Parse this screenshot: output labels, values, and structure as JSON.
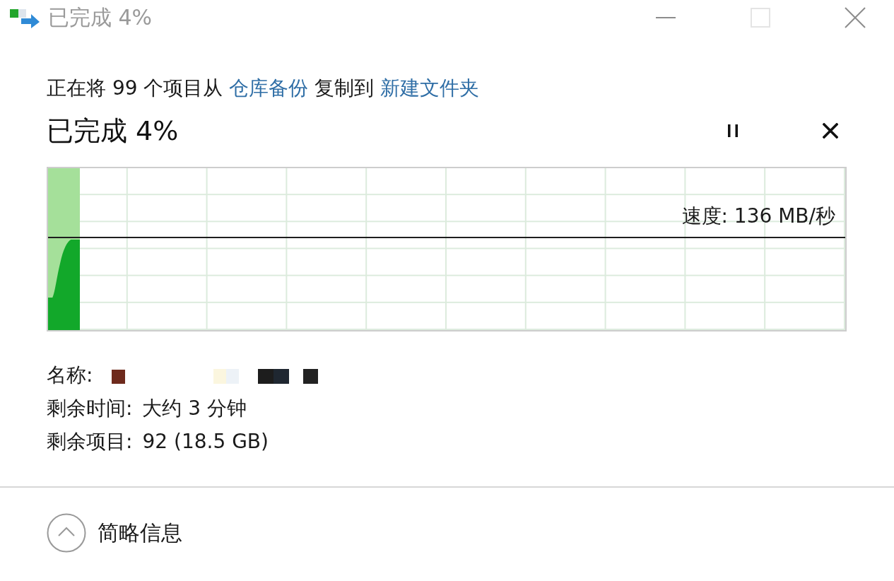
{
  "window": {
    "title": "已完成 4%",
    "controls": [
      {
        "kind": "minimize",
        "disabled": false
      },
      {
        "kind": "maximize",
        "disabled": true
      },
      {
        "kind": "close",
        "disabled": false
      }
    ]
  },
  "description": {
    "prefix": "正在将 99 个项目从",
    "source": "仓库备份",
    "middle": "复制到",
    "destination": "新建文件夹"
  },
  "heading": "已完成 4%",
  "actions": [
    {
      "kind": "pause"
    },
    {
      "kind": "cancel"
    }
  ],
  "progress": {
    "level": 0.04,
    "speed": "速度: 136 MB/秒"
  },
  "details": [
    {
      "kind": "redacted",
      "label": "名称:"
    },
    {
      "kind": "text",
      "label": "剩余时间:",
      "value": "大约 3 分钟"
    },
    {
      "kind": "text",
      "label": "剩余项目:",
      "value": "92 (18.5 GB)"
    }
  ],
  "footer": {
    "toggle": {
      "label": "简略信息",
      "expanded": true
    }
  }
}
